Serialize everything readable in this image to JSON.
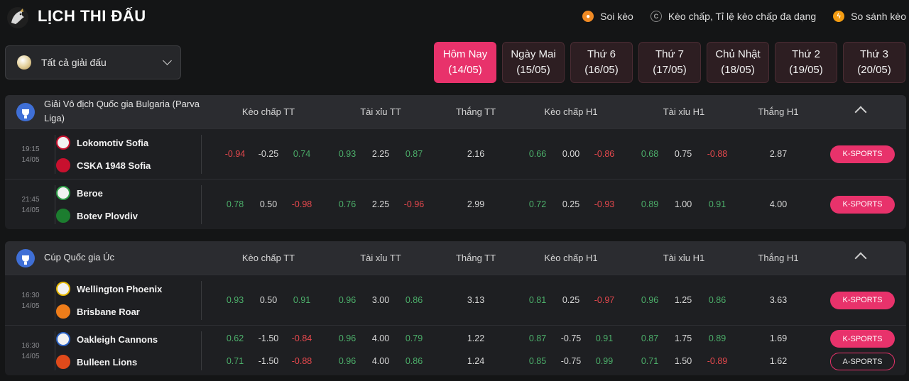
{
  "header": {
    "title": "LỊCH THI ĐẤU",
    "logo_icon": "rooster-logo-icon",
    "links": [
      {
        "label": "Soi kèo",
        "icon": "soccer-ball-icon"
      },
      {
        "label": "Kèo chấp, Tỉ lệ kèo chấp đa dạng",
        "icon": "copyright-c-icon"
      },
      {
        "label": "So sánh kèo",
        "icon": "lightning-icon"
      }
    ]
  },
  "league_filter": {
    "selected": "Tất cả giải đấu",
    "icon": "ball-icon"
  },
  "date_tabs": [
    {
      "label": "Hôm Nay",
      "date": "(14/05)",
      "active": true
    },
    {
      "label": "Ngày Mai",
      "date": "(15/05)"
    },
    {
      "label": "Thứ 6",
      "date": "(16/05)"
    },
    {
      "label": "Thứ 7",
      "date": "(17/05)"
    },
    {
      "label": "Chủ Nhật",
      "date": "(18/05)"
    },
    {
      "label": "Thứ 2",
      "date": "(19/05)"
    },
    {
      "label": "Thứ 3",
      "date": "(20/05)"
    }
  ],
  "columns": [
    "Kèo chấp TT",
    "Tài xỉu TT",
    "Thắng TT",
    "Kèo chấp H1",
    "Tài xỉu H1",
    "Thắng H1"
  ],
  "colors": {
    "accent": "#e8326b",
    "positive": "#4caf6a",
    "negative": "#e5484d"
  },
  "leagues": [
    {
      "name": "Giải Vô địch Quốc gia Bulgaria (Parva Liga)",
      "matches": [
        {
          "time": "19:15",
          "date": "14/05",
          "teams": [
            "Lokomotiv Sofia",
            "CSKA 1948 Sofia"
          ],
          "rows": [
            [
              "-0.94",
              "-0.25",
              "0.74",
              "0.93",
              "2.25",
              "0.87",
              "2.16",
              "0.66",
              "0.00",
              "-0.86",
              "0.68",
              "0.75",
              "-0.88",
              "2.87"
            ]
          ],
          "bookmakers": [
            "K-SPORTS"
          ]
        },
        {
          "time": "21:45",
          "date": "14/05",
          "teams": [
            "Beroe",
            "Botev Plovdiv"
          ],
          "rows": [
            [
              "0.78",
              "0.50",
              "-0.98",
              "0.76",
              "2.25",
              "-0.96",
              "2.99",
              "0.72",
              "0.25",
              "-0.93",
              "0.89",
              "1.00",
              "0.91",
              "4.00"
            ]
          ],
          "bookmakers": [
            "K-SPORTS"
          ]
        }
      ]
    },
    {
      "name": "Cúp Quốc gia Úc",
      "matches": [
        {
          "time": "16:30",
          "date": "14/05",
          "teams": [
            "Wellington Phoenix",
            "Brisbane Roar"
          ],
          "rows": [
            [
              "0.93",
              "0.50",
              "0.91",
              "0.96",
              "3.00",
              "0.86",
              "3.13",
              "0.81",
              "0.25",
              "-0.97",
              "0.96",
              "1.25",
              "0.86",
              "3.63"
            ]
          ],
          "bookmakers": [
            "K-SPORTS"
          ]
        },
        {
          "time": "16:30",
          "date": "14/05",
          "teams": [
            "Oakleigh Cannons",
            "Bulleen Lions"
          ],
          "rows": [
            [
              "0.62",
              "-1.50",
              "-0.84",
              "0.96",
              "4.00",
              "0.79",
              "1.22",
              "0.87",
              "-0.75",
              "0.91",
              "0.87",
              "1.75",
              "0.89",
              "1.69"
            ],
            [
              "0.71",
              "-1.50",
              "-0.88",
              "0.96",
              "4.00",
              "0.86",
              "1.24",
              "0.85",
              "-0.75",
              "0.99",
              "0.71",
              "1.50",
              "-0.89",
              "1.62"
            ]
          ],
          "bookmakers": [
            "K-SPORTS",
            "A-SPORTS"
          ]
        }
      ]
    }
  ]
}
